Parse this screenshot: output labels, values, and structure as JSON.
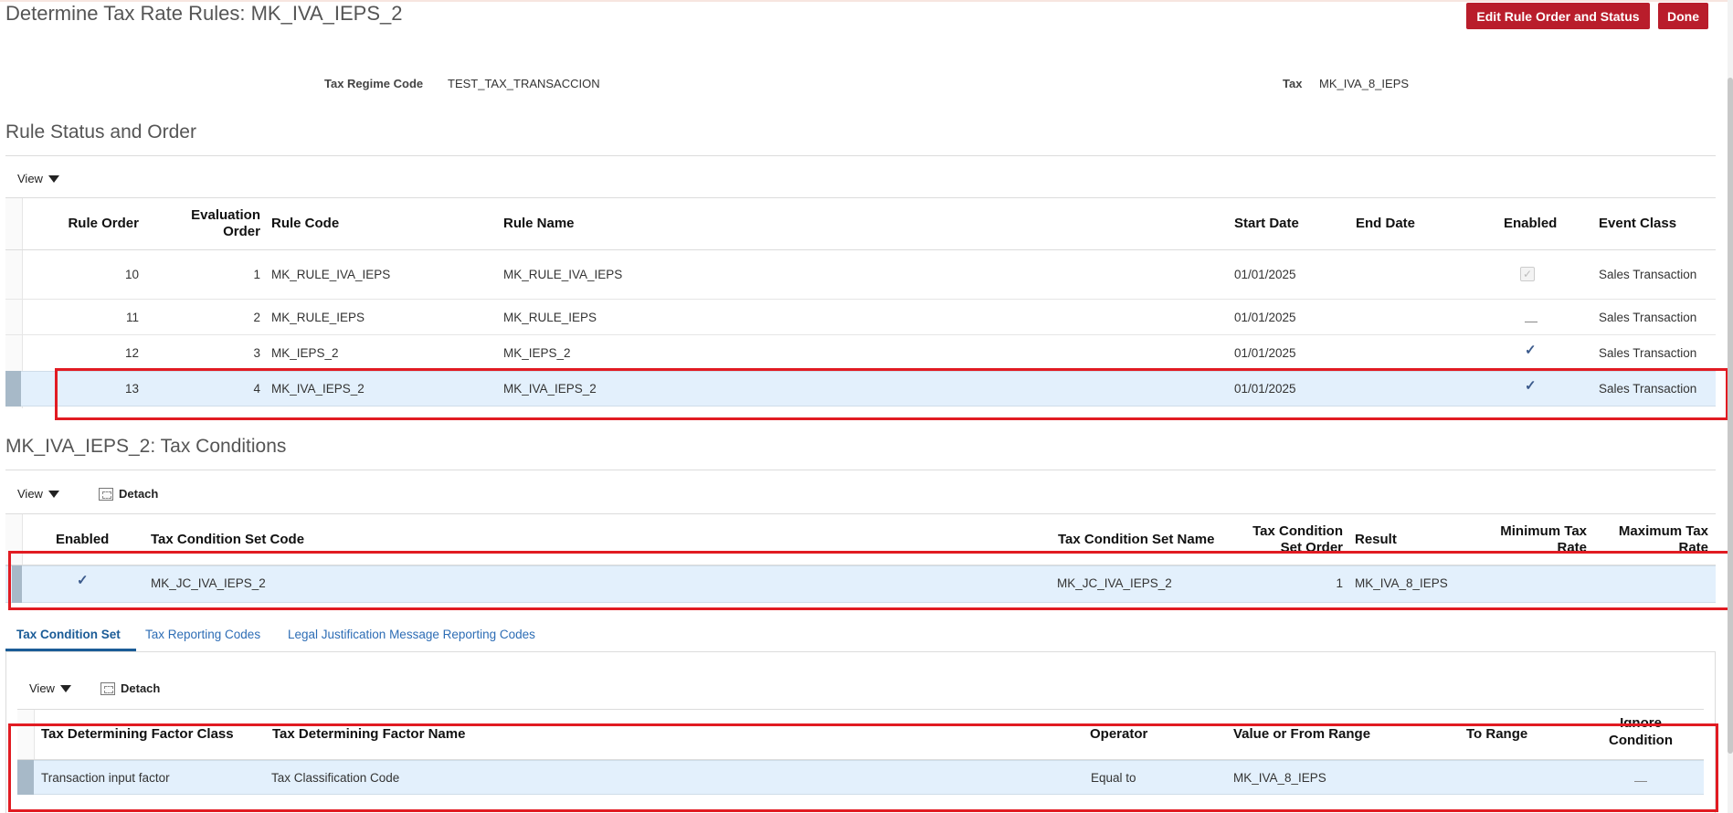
{
  "header": {
    "title": "Determine Tax Rate Rules: MK_IVA_IEPS_2",
    "edit_button": "Edit Rule Order and Status",
    "done_button": "Done"
  },
  "fields": {
    "regime_label": "Tax Regime Code",
    "regime_value": "TEST_TAX_TRANSACCION",
    "tax_label": "Tax",
    "tax_value": "MK_IVA_8_IEPS"
  },
  "rules_section": {
    "title": "Rule Status and Order",
    "view_label": "View",
    "columns": {
      "rule_order": "Rule Order",
      "eval_order_1": "Evaluation",
      "eval_order_2": "Order",
      "rule_code": "Rule Code",
      "rule_name": "Rule Name",
      "start_date": "Start Date",
      "end_date": "End Date",
      "enabled": "Enabled",
      "event_class": "Event Class"
    },
    "rows": [
      {
        "rule_order": "10",
        "eval_order": "1",
        "rule_code": "MK_RULE_IVA_IEPS",
        "rule_name": "MK_RULE_IVA_IEPS",
        "start_date": "01/01/2025",
        "end_date": "",
        "enabled": "checked-disabled",
        "event_class": "Sales Transaction"
      },
      {
        "rule_order": "11",
        "eval_order": "2",
        "rule_code": "MK_RULE_IEPS",
        "rule_name": "MK_RULE_IEPS",
        "start_date": "01/01/2025",
        "end_date": "",
        "enabled": "unchecked",
        "event_class": "Sales Transaction"
      },
      {
        "rule_order": "12",
        "eval_order": "3",
        "rule_code": "MK_IEPS_2",
        "rule_name": "MK_IEPS_2",
        "start_date": "01/01/2025",
        "end_date": "",
        "enabled": "checked",
        "event_class": "Sales Transaction"
      },
      {
        "rule_order": "13",
        "eval_order": "4",
        "rule_code": "MK_IVA_IEPS_2",
        "rule_name": "MK_IVA_IEPS_2",
        "start_date": "01/01/2025",
        "end_date": "",
        "enabled": "checked",
        "event_class": "Sales Transaction"
      }
    ]
  },
  "conditions_section": {
    "title": "MK_IVA_IEPS_2: Tax Conditions",
    "view_label": "View",
    "detach_label": "Detach",
    "columns": {
      "enabled": "Enabled",
      "set_code": "Tax Condition Set Code",
      "set_name": "Tax Condition Set Name",
      "set_order_1": "Tax Condition",
      "set_order_2": "Set Order",
      "result": "Result",
      "min_rate_1": "Minimum Tax",
      "min_rate_2": "Rate",
      "max_rate_1": "Maximum Tax",
      "max_rate_2": "Rate"
    },
    "row": {
      "enabled": "checked",
      "set_code": "MK_JC_IVA_IEPS_2",
      "set_name": "MK_JC_IVA_IEPS_2",
      "set_order": "1",
      "result": "MK_IVA_8_IEPS",
      "min_rate": "",
      "max_rate": ""
    }
  },
  "tabs": [
    {
      "label": "Tax Condition Set",
      "active": true
    },
    {
      "label": "Tax Reporting Codes",
      "active": false
    },
    {
      "label": "Legal Justification Message Reporting Codes",
      "active": false
    }
  ],
  "condition_set": {
    "view_label": "View",
    "detach_label": "Detach",
    "columns": {
      "factor_class": "Tax Determining Factor Class",
      "factor_name": "Tax Determining Factor Name",
      "operator": "Operator",
      "value_from": "Value or From Range",
      "to_range": "To Range",
      "ignore_1": "Ignore",
      "ignore_2": "Condition"
    },
    "row": {
      "factor_class": "Transaction input factor",
      "factor_name": "Tax Classification Code",
      "operator": "Equal to",
      "value_from": "MK_IVA_8_IEPS",
      "to_range": "",
      "ignore": "unchecked"
    }
  }
}
